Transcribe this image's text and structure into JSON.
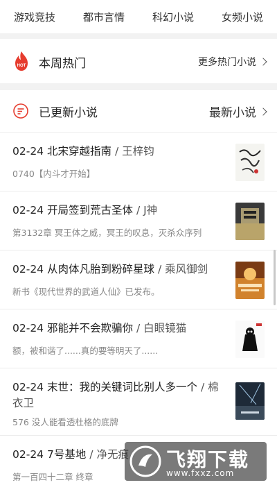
{
  "categories": [
    "游戏竞技",
    "都市言情",
    "科幻小说",
    "女频小说"
  ],
  "hot": {
    "badge": "HOT",
    "title": "本周热门",
    "more": "更多热门小说"
  },
  "updated": {
    "title": "已更新小说",
    "more": "最新小说"
  },
  "novels": [
    {
      "date": "02-24",
      "title": "北宋穿越指南",
      "author": "王梓钧",
      "desc": "0740【内斗才开始】",
      "cover_color": "#f4f4f0"
    },
    {
      "date": "02-24",
      "title": "开局签到荒古圣体",
      "author": "J神",
      "desc": "第3132章 冥王体之威，冥王的叹息，灭杀众序列",
      "cover_color": "#3a3a3a"
    },
    {
      "date": "02-24",
      "title": "从肉体凡胎到粉碎星球",
      "author": "乘风御剑",
      "desc": "新书《现代世界的武道人仙》已发布。",
      "cover_color": "#d1822c"
    },
    {
      "date": "02-24",
      "title": "邪能并不会欺骗你",
      "author": "白眼镜猫",
      "desc": "额，被和谐了......真的要等明天了......",
      "cover_color": "#fafafa"
    },
    {
      "date": "02-24",
      "title": "末世：我的关键词比别人多一个",
      "author": "棉衣卫",
      "desc": "576 没人能看透杜格的底牌",
      "cover_color": "#1e2a38"
    },
    {
      "date": "02-24",
      "title": "7号基地",
      "author": "净无痕",
      "desc": "第一百四十二章 终章",
      "cover_color": "#777777"
    }
  ],
  "watermark": {
    "cn": "飞翔下载",
    "url": "www.fxxz.com"
  },
  "colors": {
    "accent": "#e63c2e",
    "divider": "#ececec",
    "bg": "#f2f2f2"
  }
}
